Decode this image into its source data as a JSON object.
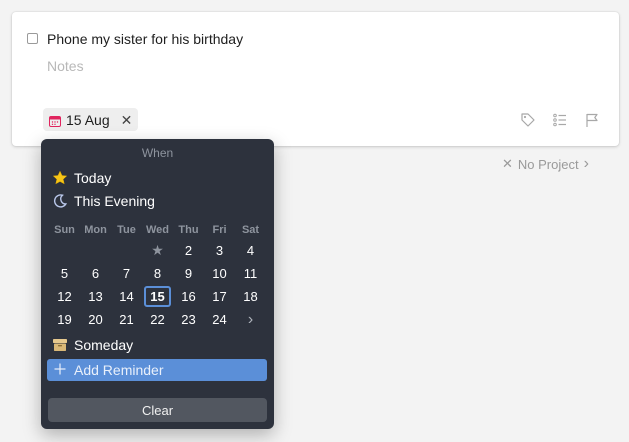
{
  "task": {
    "title": "Phone my sister for his birthday",
    "notes_placeholder": "Notes",
    "date_chip": {
      "label": "15 Aug",
      "remove_glyph": "✕"
    }
  },
  "project": {
    "label": "No Project",
    "clear_glyph": "✕",
    "arrow_glyph": "›"
  },
  "tools": [
    "tag-icon",
    "checklist-icon",
    "flag-icon"
  ],
  "picker": {
    "title": "When",
    "today_label": "Today",
    "evening_label": "This Evening",
    "weekdays": [
      "Sun",
      "Mon",
      "Tue",
      "Wed",
      "Thu",
      "Fri",
      "Sat"
    ],
    "weeks": [
      [
        "",
        "",
        "",
        "★",
        "2",
        "3",
        "4"
      ],
      [
        "5",
        "6",
        "7",
        "8",
        "9",
        "10",
        "11"
      ],
      [
        "12",
        "13",
        "14",
        "15",
        "16",
        "17",
        "18"
      ],
      [
        "19",
        "20",
        "21",
        "22",
        "23",
        "24",
        "›"
      ]
    ],
    "selected_day": "15",
    "someday_label": "Someday",
    "add_reminder_label": "Add Reminder",
    "clear_label": "Clear"
  },
  "colors": {
    "accent": "#5b8fd8",
    "popup_bg": "#2d323d",
    "chip_bg": "#eeeeee",
    "calendar_red": "#e0245e"
  }
}
